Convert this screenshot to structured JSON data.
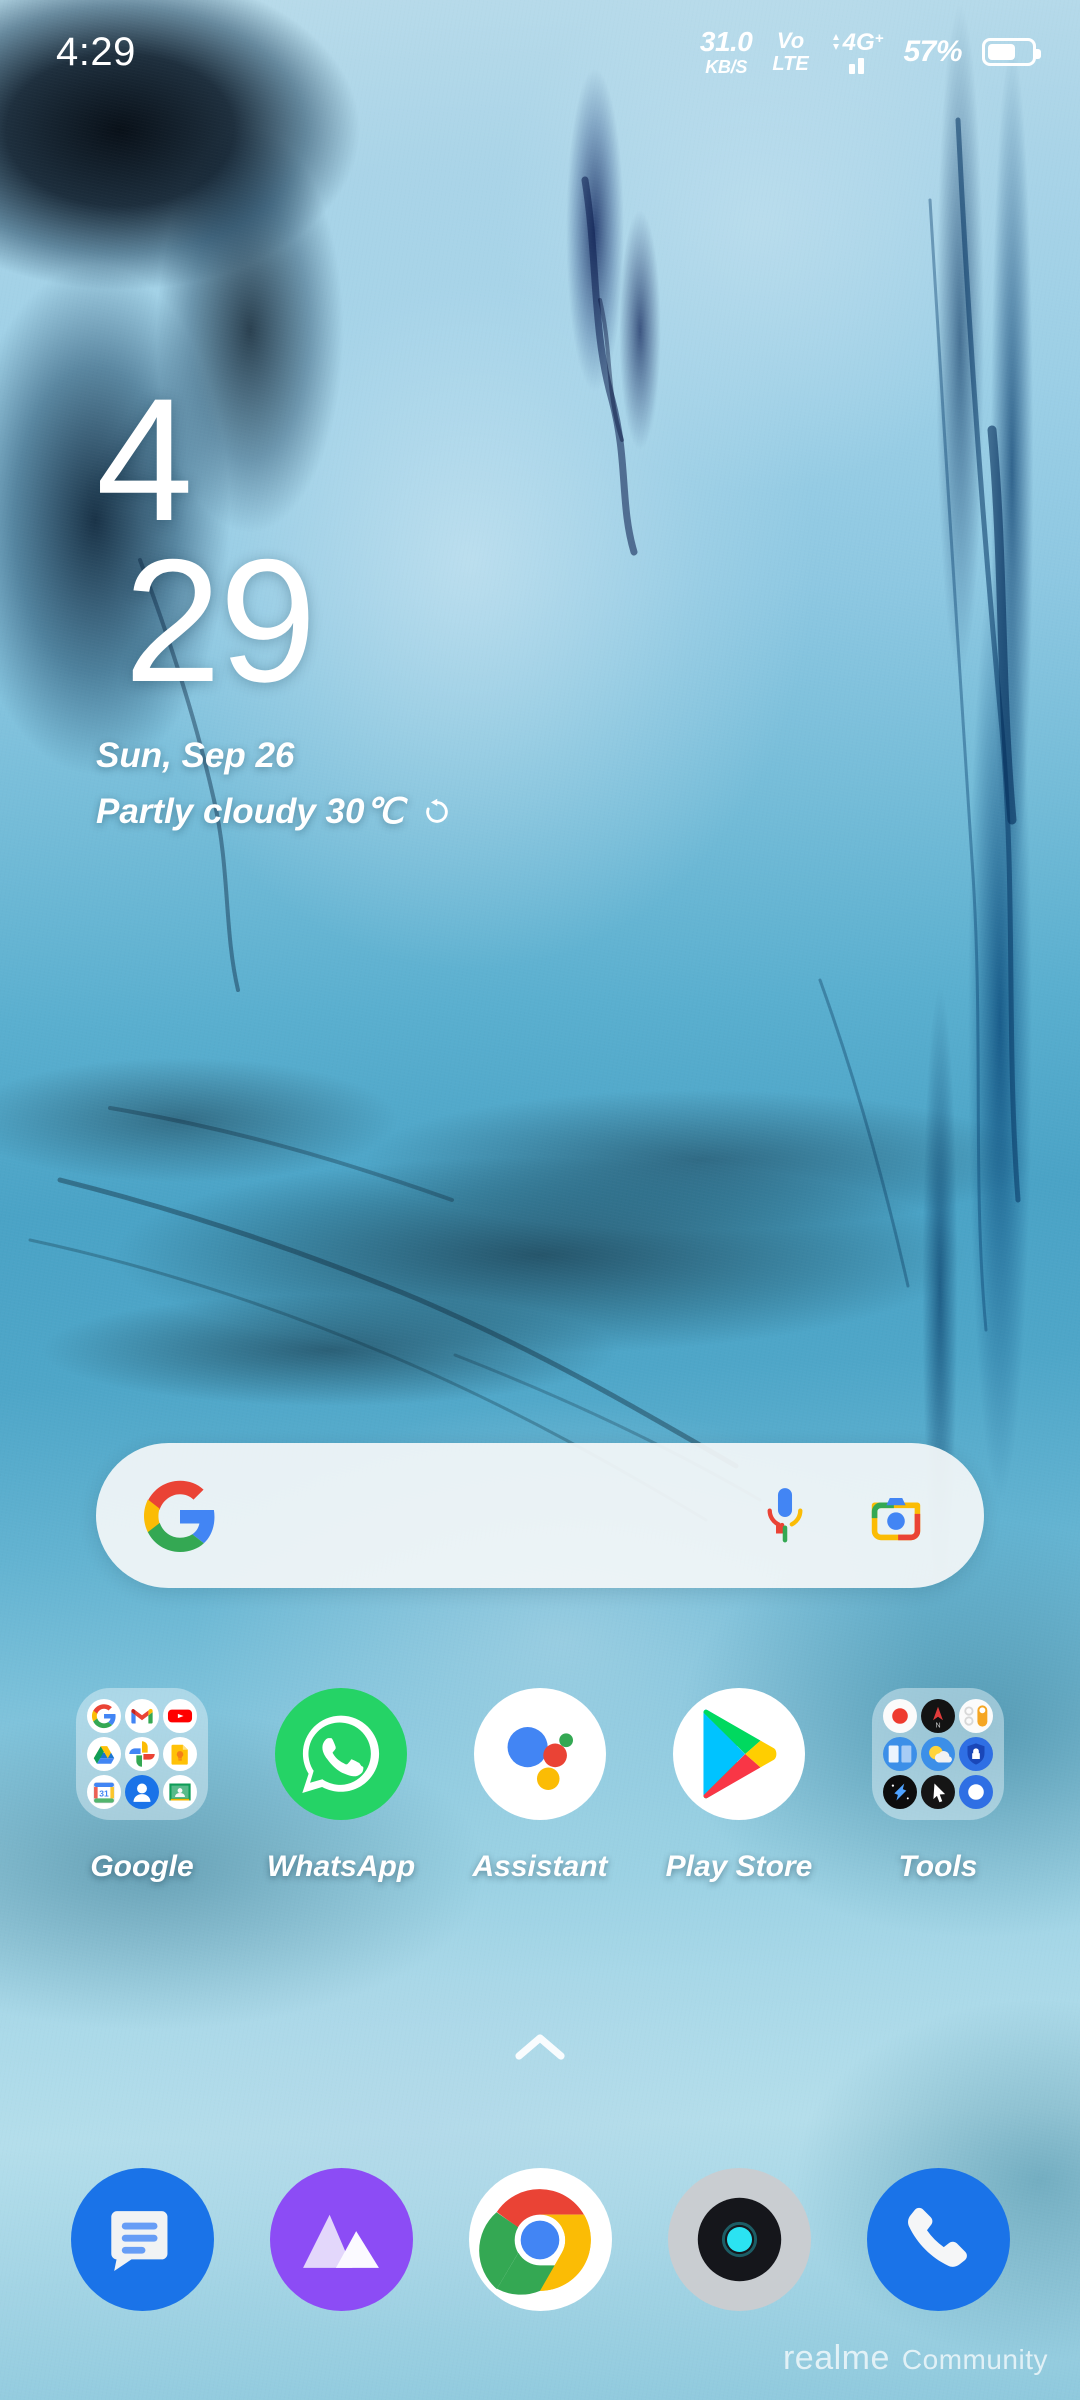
{
  "status_bar": {
    "clock": "4:29",
    "net_speed_value": "31.0",
    "net_speed_unit": "KB/S",
    "volte_line1": "Vo",
    "volte_line2": "LTE",
    "network_type": "4G",
    "network_sup": "+",
    "battery_percent": "57%",
    "battery_level": 57
  },
  "clock_widget": {
    "hour": "4",
    "minute": "29",
    "date": "Sun, Sep 26",
    "weather": "Partly cloudy 30℃",
    "refresh_icon": "refresh-icon"
  },
  "search": {
    "placeholder": "",
    "value": "",
    "google_icon": "google-g-icon",
    "mic_icon": "microphone-icon",
    "lens_icon": "google-lens-camera-icon"
  },
  "app_grid": [
    {
      "label": "Google",
      "type": "folder",
      "mini_icons": [
        "google-g-icon",
        "gmail-icon",
        "youtube-icon",
        "google-drive-icon",
        "google-photos-icon",
        "google-keep-icon",
        "google-calendar-icon",
        "google-contacts-icon",
        "google-classroom-icon"
      ]
    },
    {
      "label": "WhatsApp",
      "type": "app",
      "icon": "whatsapp-icon",
      "color": "#25D366"
    },
    {
      "label": "Assistant",
      "type": "app",
      "icon": "google-assistant-icon",
      "color": "#FFFFFF"
    },
    {
      "label": "Play Store",
      "type": "app",
      "icon": "google-play-store-icon",
      "color": "#FFFFFF"
    },
    {
      "label": "Tools",
      "type": "folder",
      "mini_icons": [
        "screen-recorder-icon",
        "compass-icon",
        "quick-settings-icon",
        "split-screen-icon",
        "weather-icon",
        "security-shield-icon",
        "game-space-icon",
        "cursor-icon",
        "phone-manager-icon"
      ]
    }
  ],
  "drawer_indicator": {
    "icon": "chevron-up-icon"
  },
  "dock": [
    {
      "label": "Messages",
      "icon": "messages-icon",
      "color": "#1A73E8"
    },
    {
      "label": "Photos",
      "icon": "gallery-icon",
      "color": "#8C4CF5"
    },
    {
      "label": "Chrome",
      "icon": "chrome-icon",
      "color": "#FFFFFF"
    },
    {
      "label": "Camera",
      "icon": "camera-icon",
      "color": "#C9CDD1"
    },
    {
      "label": "Phone",
      "icon": "phone-icon",
      "color": "#1A73E8"
    }
  ],
  "watermark": {
    "brand": "realme",
    "suffix": "Community"
  },
  "theme": {
    "accent": "#1A73E8",
    "google_blue": "#4285F4",
    "google_red": "#EA4335",
    "google_yellow": "#FBBC05",
    "google_green": "#34A853",
    "whatsapp_green": "#25D366",
    "search_bg": "#F3F6F7"
  }
}
